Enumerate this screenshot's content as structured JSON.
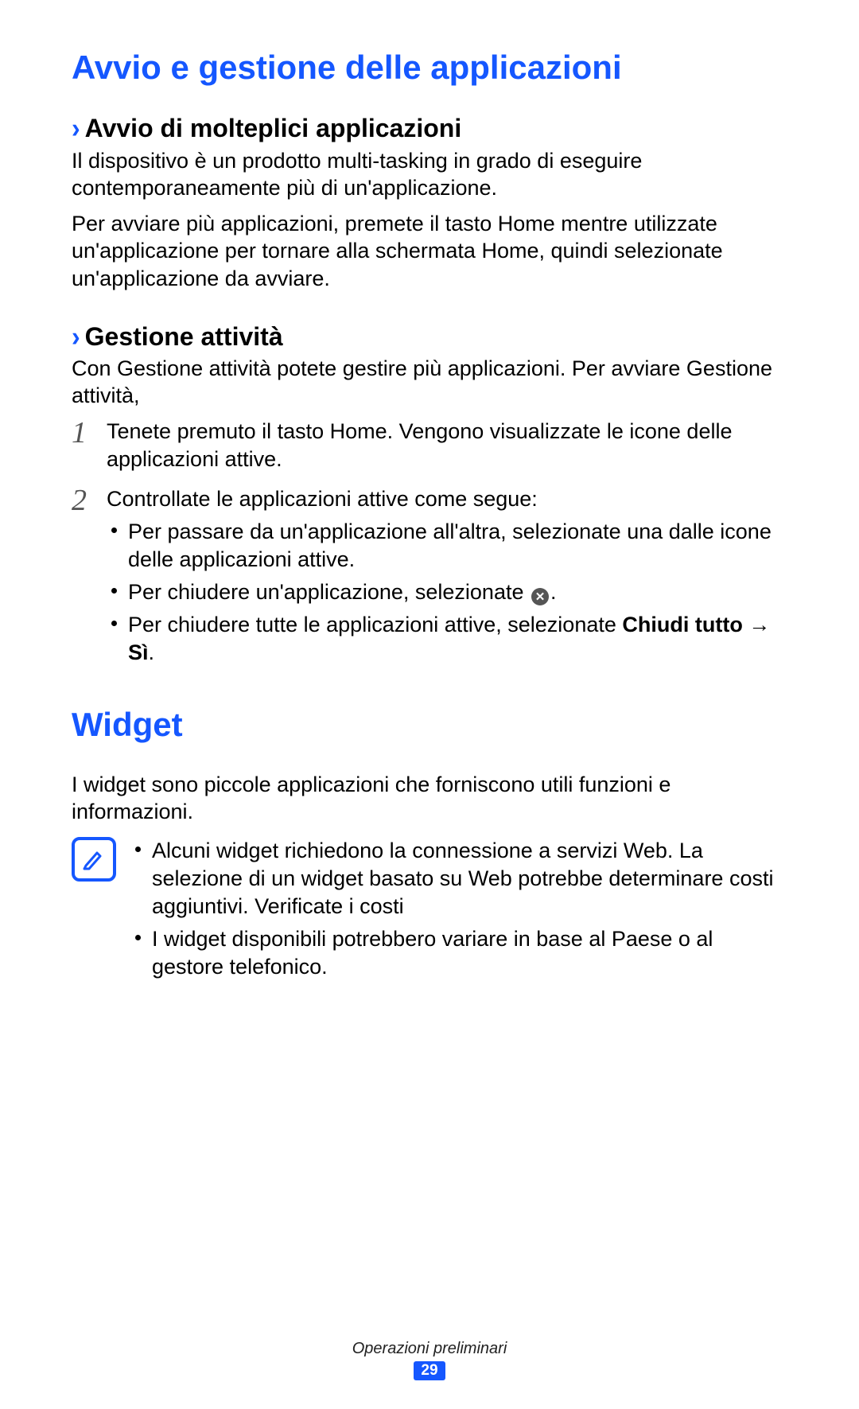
{
  "heading1": "Avvio e gestione delle applicazioni",
  "section1": {
    "title": "Avvio di molteplici applicazioni",
    "p1": "Il dispositivo è un prodotto multi-tasking in grado di eseguire contemporaneamente più di un'applicazione.",
    "p2": "Per avviare più applicazioni, premete il tasto Home mentre utilizzate un'applicazione per tornare alla schermata Home, quindi selezionate un'applicazione da avviare."
  },
  "section2": {
    "title": "Gestione attività",
    "intro": "Con Gestione attività potete gestire più applicazioni. Per avviare Gestione attività,",
    "step1": "Tenete premuto il tasto Home. Vengono visualizzate le icone delle applicazioni attive.",
    "step2_lead": "Controllate le applicazioni attive come segue:",
    "b1": "Per passare da un'applicazione all'altra, selezionate una dalle icone delle applicazioni attive.",
    "b2_pre": "Per chiudere un'applicazione, selezionate ",
    "b2_post": ".",
    "b3_pre": "Per chiudere tutte le applicazioni attive, selezionate ",
    "b3_bold1": "Chiudi tutto",
    "b3_arrow": " → ",
    "b3_bold2": "Sì",
    "b3_post": "."
  },
  "heading2": "Widget",
  "widget_intro": "I widget sono piccole applicazioni che forniscono utili funzioni e informazioni.",
  "note": {
    "n1": "Alcuni widget richiedono la connessione a servizi Web. La selezione di un widget basato su Web potrebbe determinare costi aggiuntivi. Verificate i costi",
    "n2": "I widget disponibili potrebbero variare in base al Paese o al gestore telefonico."
  },
  "footer_label": "Operazioni preliminari",
  "page_number": "29"
}
